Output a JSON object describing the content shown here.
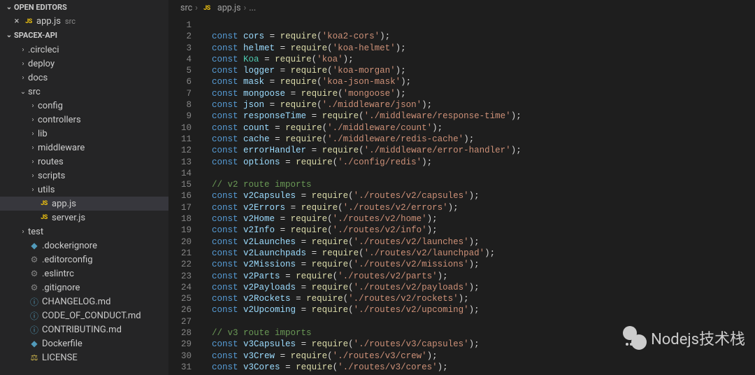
{
  "sections": {
    "open_editors": "OPEN EDITORS",
    "root": "SPACEX-API"
  },
  "open_tab": {
    "name": "app.js",
    "dir": "src"
  },
  "tree": [
    {
      "name": ".circleci",
      "kind": "folder",
      "depth": 1
    },
    {
      "name": "deploy",
      "kind": "folder",
      "depth": 1
    },
    {
      "name": "docs",
      "kind": "folder",
      "depth": 1
    },
    {
      "name": "src",
      "kind": "folder",
      "depth": 1,
      "open": true
    },
    {
      "name": "config",
      "kind": "folder",
      "depth": 2
    },
    {
      "name": "controllers",
      "kind": "folder",
      "depth": 2
    },
    {
      "name": "lib",
      "kind": "folder",
      "depth": 2
    },
    {
      "name": "middleware",
      "kind": "folder",
      "depth": 2
    },
    {
      "name": "routes",
      "kind": "folder",
      "depth": 2
    },
    {
      "name": "scripts",
      "kind": "folder",
      "depth": 2
    },
    {
      "name": "utils",
      "kind": "folder",
      "depth": 2
    },
    {
      "name": "app.js",
      "kind": "js",
      "depth": 2,
      "selected": true
    },
    {
      "name": "server.js",
      "kind": "js",
      "depth": 2
    },
    {
      "name": "test",
      "kind": "folder",
      "depth": 1
    },
    {
      "name": ".dockerignore",
      "kind": "docker",
      "depth": 1
    },
    {
      "name": ".editorconfig",
      "kind": "gear",
      "depth": 1
    },
    {
      "name": ".eslintrc",
      "kind": "gear",
      "depth": 1
    },
    {
      "name": ".gitignore",
      "kind": "gear",
      "depth": 1
    },
    {
      "name": "CHANGELOG.md",
      "kind": "info",
      "depth": 1
    },
    {
      "name": "CODE_OF_CONDUCT.md",
      "kind": "info",
      "depth": 1
    },
    {
      "name": "CONTRIBUTING.md",
      "kind": "info",
      "depth": 1
    },
    {
      "name": "Dockerfile",
      "kind": "docker",
      "depth": 1
    },
    {
      "name": "LICENSE",
      "kind": "license",
      "depth": 1
    }
  ],
  "breadcrumbs": {
    "a": "src",
    "b": "app.js",
    "c": "..."
  },
  "code": {
    "start": 1,
    "lines": [
      {
        "t": "blank"
      },
      {
        "t": "req",
        "v": "cors",
        "s": "koa2-cors"
      },
      {
        "t": "req",
        "v": "helmet",
        "s": "koa-helmet"
      },
      {
        "t": "req",
        "v": "Koa",
        "s": "koa",
        "cls": true
      },
      {
        "t": "req",
        "v": "logger",
        "s": "koa-morgan"
      },
      {
        "t": "req",
        "v": "mask",
        "s": "koa-json-mask"
      },
      {
        "t": "req",
        "v": "mongoose",
        "s": "mongoose"
      },
      {
        "t": "req",
        "v": "json",
        "s": "./middleware/json"
      },
      {
        "t": "req",
        "v": "responseTime",
        "s": "./middleware/response-time"
      },
      {
        "t": "req",
        "v": "count",
        "s": "./middleware/count"
      },
      {
        "t": "req",
        "v": "cache",
        "s": "./middleware/redis-cache"
      },
      {
        "t": "req",
        "v": "errorHandler",
        "s": "./middleware/error-handler"
      },
      {
        "t": "req",
        "v": "options",
        "s": "./config/redis"
      },
      {
        "t": "blank"
      },
      {
        "t": "cmt",
        "c": "// v2 route imports"
      },
      {
        "t": "req",
        "v": "v2Capsules",
        "s": "./routes/v2/capsules"
      },
      {
        "t": "req",
        "v": "v2Errors",
        "s": "./routes/v2/errors"
      },
      {
        "t": "req",
        "v": "v2Home",
        "s": "./routes/v2/home"
      },
      {
        "t": "req",
        "v": "v2Info",
        "s": "./routes/v2/info"
      },
      {
        "t": "req",
        "v": "v2Launches",
        "s": "./routes/v2/launches"
      },
      {
        "t": "req",
        "v": "v2Launchpads",
        "s": "./routes/v2/launchpad"
      },
      {
        "t": "req",
        "v": "v2Missions",
        "s": "./routes/v2/missions"
      },
      {
        "t": "req",
        "v": "v2Parts",
        "s": "./routes/v2/parts"
      },
      {
        "t": "req",
        "v": "v2Payloads",
        "s": "./routes/v2/payloads"
      },
      {
        "t": "req",
        "v": "v2Rockets",
        "s": "./routes/v2/rockets"
      },
      {
        "t": "req",
        "v": "v2Upcoming",
        "s": "./routes/v2/upcoming"
      },
      {
        "t": "blank"
      },
      {
        "t": "cmt",
        "c": "// v3 route imports"
      },
      {
        "t": "req",
        "v": "v3Capsules",
        "s": "./routes/v3/capsules"
      },
      {
        "t": "req",
        "v": "v3Crew",
        "s": "./routes/v3/crew"
      },
      {
        "t": "req",
        "v": "v3Cores",
        "s": "./routes/v3/cores"
      }
    ]
  },
  "watermark": "Nodejs技术栈"
}
